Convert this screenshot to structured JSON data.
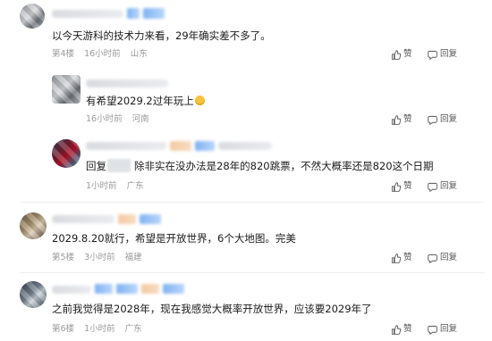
{
  "comments": [
    {
      "text": "以今天游科的技术力来看，29年确实差不多了。",
      "floor": "第4楼",
      "time": "16小时前",
      "location": "山东",
      "like_label": "赞",
      "reply_label": "回复"
    },
    {
      "text": "有希望2029.2过年玩上",
      "floor": "",
      "time": "16小时前",
      "location": "河南",
      "like_label": "赞",
      "reply_label": "回复"
    },
    {
      "text_prefix": "回复",
      "text": "除非实在没办法是28年的820跳票，不然大概率还是820这个日期",
      "floor": "",
      "time": "1小时前",
      "location": "广东",
      "like_label": "赞",
      "reply_label": "回复"
    },
    {
      "text": "2029.8.20就行，希望是开放世界，6个大地图。完美",
      "floor": "第5楼",
      "time": "3小时前",
      "location": "福建",
      "like_label": "赞",
      "reply_label": "回复"
    },
    {
      "text": "之前我觉得是2028年，现在我感觉大概率开放世界，应该要2029年了",
      "floor": "第6楼",
      "time": "1小时前",
      "location": "广东",
      "like_label": "赞",
      "reply_label": "回复"
    }
  ],
  "icons": {
    "like": "thumbs-up-icon",
    "reply": "speech-bubble-icon"
  },
  "colors": {
    "meta_text": "#9a9a9a",
    "body_text": "#1a1a1a",
    "badge_blue": "#7fb2f0"
  }
}
